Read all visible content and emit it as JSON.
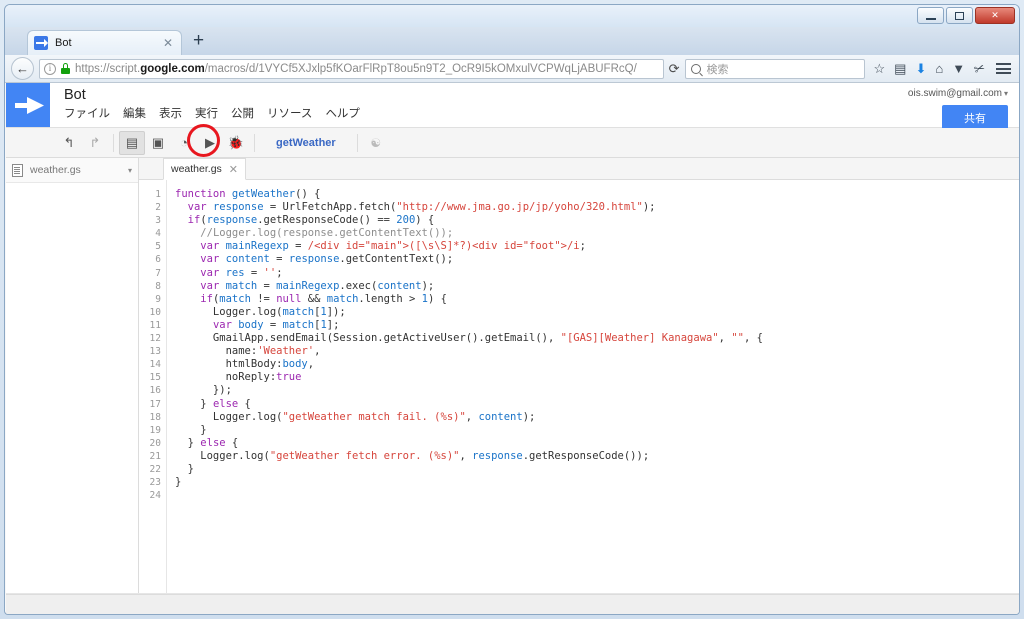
{
  "window": {
    "minimize_label": "—",
    "maximize_label": "❐",
    "close_label": "✕"
  },
  "browser": {
    "tab": {
      "title": "Bot",
      "close_label": "✕",
      "favicon": "apps-script-icon"
    },
    "new_tab_label": "+",
    "back_label": "←",
    "reload_label": "⟳",
    "url_scheme": "https://",
    "url_domain_pre": "script.",
    "url_domain_bold": "google.com",
    "url_path": "/macros/d/1VYCf5XJxlp5fKOarFlRpT8ou5n9T2_OcR9I5kOMxulVCPWqLjABUFRcQ/",
    "search_placeholder": "検索",
    "icons": {
      "info": "i",
      "lock": "lock-icon",
      "bookmark": "☆",
      "reader": "▤",
      "download": "⬇",
      "home": "⌂",
      "pocket": "▼",
      "addon": "addon-icon",
      "menu": "hamburger-icon"
    }
  },
  "gas": {
    "project_name": "Bot",
    "menu": [
      "ファイル",
      "編集",
      "表示",
      "実行",
      "公開",
      "リソース",
      "ヘルプ"
    ],
    "account_email": "ois.swim@gmail.com",
    "account_caret": "▾",
    "share_label": "共有",
    "toolbar": {
      "undo": "↰",
      "redo": "↱",
      "indent": "▤",
      "save": "▣",
      "history": "◔",
      "run": "▶",
      "debug": "🐞",
      "function_name": "getWeather",
      "hint": "💡"
    },
    "sidebar": {
      "files": [
        {
          "name": "weather.gs",
          "caret": "▾"
        }
      ]
    },
    "editor": {
      "open_tab": {
        "name": "weather.gs",
        "close": "✕"
      },
      "line_numbers": [
        1,
        2,
        3,
        4,
        5,
        6,
        7,
        8,
        9,
        10,
        11,
        12,
        13,
        14,
        15,
        16,
        17,
        18,
        19,
        20,
        21,
        22,
        23,
        24
      ],
      "lines": [
        [
          {
            "t": "function",
            "c": "k"
          },
          {
            "t": " ",
            "c": "plain"
          },
          {
            "t": "getWeather",
            "c": "id"
          },
          {
            "t": "() {",
            "c": "plain"
          }
        ],
        [
          {
            "t": "  ",
            "c": "plain"
          },
          {
            "t": "var",
            "c": "k"
          },
          {
            "t": " ",
            "c": "plain"
          },
          {
            "t": "response",
            "c": "id"
          },
          {
            "t": " = UrlFetchApp.fetch(",
            "c": "plain"
          },
          {
            "t": "\"http://www.jma.go.jp/jp/yoho/320.html\"",
            "c": "str"
          },
          {
            "t": ");",
            "c": "plain"
          }
        ],
        [
          {
            "t": "  ",
            "c": "plain"
          },
          {
            "t": "if",
            "c": "k"
          },
          {
            "t": "(",
            "c": "plain"
          },
          {
            "t": "response",
            "c": "id"
          },
          {
            "t": ".getResponseCode() == ",
            "c": "plain"
          },
          {
            "t": "200",
            "c": "num"
          },
          {
            "t": ") {",
            "c": "plain"
          }
        ],
        [
          {
            "t": "    ",
            "c": "plain"
          },
          {
            "t": "//Logger.log(response.getContentText());",
            "c": "cmt"
          }
        ],
        [
          {
            "t": "    ",
            "c": "plain"
          },
          {
            "t": "var",
            "c": "k"
          },
          {
            "t": " ",
            "c": "plain"
          },
          {
            "t": "mainRegexp",
            "c": "id"
          },
          {
            "t": " = ",
            "c": "plain"
          },
          {
            "t": "/<div id=\"main\">([\\s\\S]*?)<div id=\"foot\">/i",
            "c": "rx"
          },
          {
            "t": ";",
            "c": "plain"
          }
        ],
        [
          {
            "t": "    ",
            "c": "plain"
          },
          {
            "t": "var",
            "c": "k"
          },
          {
            "t": " ",
            "c": "plain"
          },
          {
            "t": "content",
            "c": "id"
          },
          {
            "t": " = ",
            "c": "plain"
          },
          {
            "t": "response",
            "c": "id"
          },
          {
            "t": ".getContentText();",
            "c": "plain"
          }
        ],
        [
          {
            "t": "    ",
            "c": "plain"
          },
          {
            "t": "var",
            "c": "k"
          },
          {
            "t": " ",
            "c": "plain"
          },
          {
            "t": "res",
            "c": "id"
          },
          {
            "t": " = ",
            "c": "plain"
          },
          {
            "t": "''",
            "c": "str"
          },
          {
            "t": ";",
            "c": "plain"
          }
        ],
        [
          {
            "t": "    ",
            "c": "plain"
          },
          {
            "t": "var",
            "c": "k"
          },
          {
            "t": " ",
            "c": "plain"
          },
          {
            "t": "match",
            "c": "id"
          },
          {
            "t": " = ",
            "c": "plain"
          },
          {
            "t": "mainRegexp",
            "c": "id"
          },
          {
            "t": ".exec(",
            "c": "plain"
          },
          {
            "t": "content",
            "c": "id"
          },
          {
            "t": ");",
            "c": "plain"
          }
        ],
        [
          {
            "t": "    ",
            "c": "plain"
          },
          {
            "t": "if",
            "c": "k"
          },
          {
            "t": "(",
            "c": "plain"
          },
          {
            "t": "match",
            "c": "id"
          },
          {
            "t": " != ",
            "c": "plain"
          },
          {
            "t": "null",
            "c": "k"
          },
          {
            "t": " && ",
            "c": "plain"
          },
          {
            "t": "match",
            "c": "id"
          },
          {
            "t": ".length > ",
            "c": "plain"
          },
          {
            "t": "1",
            "c": "num"
          },
          {
            "t": ") {",
            "c": "plain"
          }
        ],
        [
          {
            "t": "      Logger.log(",
            "c": "plain"
          },
          {
            "t": "match",
            "c": "id"
          },
          {
            "t": "[",
            "c": "plain"
          },
          {
            "t": "1",
            "c": "num"
          },
          {
            "t": "]);",
            "c": "plain"
          }
        ],
        [
          {
            "t": "      ",
            "c": "plain"
          },
          {
            "t": "var",
            "c": "k"
          },
          {
            "t": " ",
            "c": "plain"
          },
          {
            "t": "body",
            "c": "id"
          },
          {
            "t": " = ",
            "c": "plain"
          },
          {
            "t": "match",
            "c": "id"
          },
          {
            "t": "[",
            "c": "plain"
          },
          {
            "t": "1",
            "c": "num"
          },
          {
            "t": "];",
            "c": "plain"
          }
        ],
        [
          {
            "t": "      GmailApp.sendEmail(Session.getActiveUser().getEmail(), ",
            "c": "plain"
          },
          {
            "t": "\"[GAS][Weather] Kanagawa\"",
            "c": "str"
          },
          {
            "t": ", ",
            "c": "plain"
          },
          {
            "t": "\"\"",
            "c": "str"
          },
          {
            "t": ", {",
            "c": "plain"
          }
        ],
        [
          {
            "t": "        name:",
            "c": "plain"
          },
          {
            "t": "'Weather'",
            "c": "str"
          },
          {
            "t": ",",
            "c": "plain"
          }
        ],
        [
          {
            "t": "        htmlBody:",
            "c": "plain"
          },
          {
            "t": "body",
            "c": "id"
          },
          {
            "t": ",",
            "c": "plain"
          }
        ],
        [
          {
            "t": "        noReply:",
            "c": "plain"
          },
          {
            "t": "true",
            "c": "k"
          }
        ],
        [
          {
            "t": "      });",
            "c": "plain"
          }
        ],
        [
          {
            "t": "    } ",
            "c": "plain"
          },
          {
            "t": "else",
            "c": "k"
          },
          {
            "t": " {",
            "c": "plain"
          }
        ],
        [
          {
            "t": "      Logger.log(",
            "c": "plain"
          },
          {
            "t": "\"getWeather match fail. (%s)\"",
            "c": "str"
          },
          {
            "t": ", ",
            "c": "plain"
          },
          {
            "t": "content",
            "c": "id"
          },
          {
            "t": ");",
            "c": "plain"
          }
        ],
        [
          {
            "t": "    }",
            "c": "plain"
          }
        ],
        [
          {
            "t": "  } ",
            "c": "plain"
          },
          {
            "t": "else",
            "c": "k"
          },
          {
            "t": " {",
            "c": "plain"
          }
        ],
        [
          {
            "t": "    Logger.log(",
            "c": "plain"
          },
          {
            "t": "\"getWeather fetch error. (%s)\"",
            "c": "str"
          },
          {
            "t": ", ",
            "c": "plain"
          },
          {
            "t": "response",
            "c": "id"
          },
          {
            "t": ".getResponseCode());",
            "c": "plain"
          }
        ],
        [
          {
            "t": "  }",
            "c": "plain"
          }
        ],
        [
          {
            "t": "}",
            "c": "plain"
          }
        ],
        [
          {
            "t": "",
            "c": "plain"
          }
        ]
      ]
    },
    "annotation": {
      "shape": "red-ellipse",
      "color": "#e8171f",
      "target": "run-button"
    }
  }
}
